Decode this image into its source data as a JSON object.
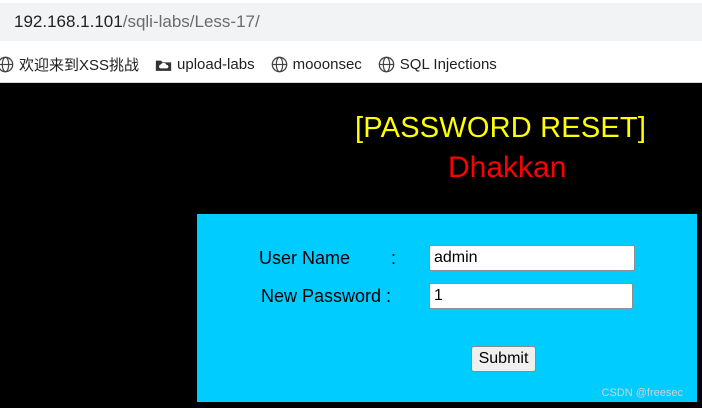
{
  "browser": {
    "url_host": "192.168.1.101",
    "url_path": "/sqli-labs/Less-17/"
  },
  "bookmarks": [
    {
      "label": "欢迎来到XSS挑战",
      "icon": "globe-icon"
    },
    {
      "label": "upload-labs",
      "icon": "cloud-folder-icon"
    },
    {
      "label": "mooonsec",
      "icon": "globe-icon"
    },
    {
      "label": "SQL Injections",
      "icon": "globe-icon"
    }
  ],
  "page": {
    "title": "[PASSWORD RESET]",
    "subtitle": "Dhakkan",
    "title_color": "#ffff00",
    "subtitle_color": "#ff0000",
    "panel_color": "#00ccff"
  },
  "form": {
    "username_label": "User Name",
    "username_colon": ":",
    "username_value": "admin",
    "password_label": "New Password :",
    "password_value": "1",
    "submit_label": "Submit"
  },
  "watermark": "CSDN @freesec"
}
